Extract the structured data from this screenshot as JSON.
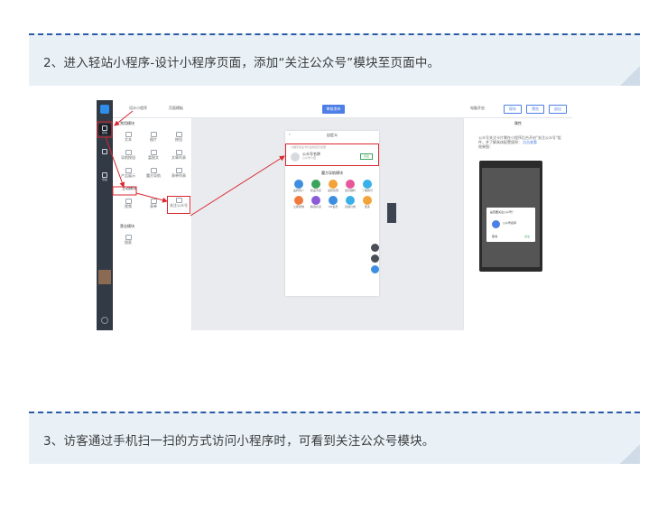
{
  "steps": [
    {
      "text": "2、进入轻站小程序-设计小程序页面，添加“关注公众号”模块至页面中。"
    },
    {
      "text": "3、访客通过手机扫一扫的方式访问小程序时，可看到关注公众号模块。"
    }
  ],
  "screenshot": {
    "sidebar": {
      "items": [
        {
          "label": "模块"
        },
        {
          "label": ""
        },
        {
          "label": "导航"
        }
      ]
    },
    "topbar": {
      "app_select": "设计小程序",
      "page_settings": "页面模板",
      "publish_label": "审核发布",
      "preview_label": "电脑开启",
      "save_label": "保存",
      "view_label": "预览",
      "exit_label": "退出"
    },
    "left_panel": {
      "section_common": "常用模块",
      "common_items": [
        "文本",
        "图片",
        "按钮",
        "导航按钮",
        "富图文",
        "文章列表",
        "产品展示",
        "魔方导航",
        "表单列表",
        "分类",
        "",
        ""
      ],
      "section_advanced": "互动模块",
      "advanced_items": [
        "视频",
        "表单",
        "关注公众号"
      ],
      "section_other": "营业模块",
      "other_items": [
        "搜索"
      ]
    },
    "phone": {
      "title": "自定义",
      "back": "‹",
      "follow_hint": "小程序关注卡片后将显示这里",
      "follow_name": "公众号名称",
      "follow_sub": "公众号介绍",
      "follow_button": "关注",
      "nav_title": "魔方导航模块",
      "nav_items": [
        {
          "label": "品牌简介",
          "color": "#3c8fe0"
        },
        {
          "label": "新品专区",
          "color": "#3aa55a"
        },
        {
          "label": "最新优惠",
          "color": "#f2a33a"
        },
        {
          "label": "会员福利",
          "color": "#e8579b"
        },
        {
          "label": "了解我们",
          "color": "#3ab0e8"
        },
        {
          "label": "立即抢购",
          "color": "#f07a3c"
        },
        {
          "label": "精选好货",
          "color": "#8a5ad9"
        },
        {
          "label": "VIP会员",
          "color": "#3c8fe0"
        },
        {
          "label": "店铺分类",
          "color": "#3ab0e8"
        },
        {
          "label": "更多",
          "color": "#f2a33a"
        }
      ]
    },
    "right_panel": {
      "title": "属性",
      "description": "公众号关注卡片需在小程序后台开启\"关注公众号\"组件，并了解具体配置规则：",
      "link": "点击查看",
      "tips": "效果图：",
      "dialog_question": "是否要关注公众号？",
      "dialog_name": "公众号名称",
      "dialog_cancel": "取消",
      "dialog_ok": "关注"
    }
  }
}
